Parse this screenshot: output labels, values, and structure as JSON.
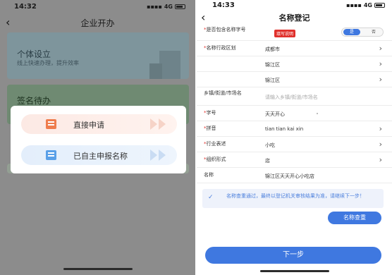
{
  "left": {
    "status": {
      "time": "14:32",
      "network": "4G"
    },
    "nav": {
      "title": "企业开办"
    },
    "card1": {
      "title": "个体设立",
      "subtitle": "线上快速办理，提升效率"
    },
    "card2": {
      "title": "签名待办"
    },
    "modal": {
      "options": [
        {
          "label": "直接申请",
          "icon": "document-icon"
        },
        {
          "label": "已自主申报名称",
          "icon": "form-icon"
        }
      ]
    }
  },
  "right": {
    "status": {
      "time": "14:33",
      "network": "4G"
    },
    "nav": {
      "title": "名称登记"
    },
    "form": {
      "include_name": {
        "label": "是否包含名称字号",
        "required": "*",
        "hint": "填写说明",
        "yes": "是",
        "no": "否",
        "selected": "是"
      },
      "region": {
        "label": "名称行政区划",
        "required": "*",
        "city": "成都市",
        "district": "锦江区",
        "district2": "锦江区"
      },
      "street": {
        "label": "乡镇/街道/市场名",
        "placeholder": "请输入乡镇/街道/市场名"
      },
      "trade_name": {
        "label": "字号",
        "required": "*",
        "value": "天天开心"
      },
      "pinyin": {
        "label": "拼音",
        "required": "*",
        "value": "tian tian kai xin"
      },
      "industry": {
        "label": "行业表述",
        "required": "*",
        "value": "小吃"
      },
      "org_form": {
        "label": "组织形式",
        "required": "*",
        "value": "店"
      },
      "name": {
        "label": "名称",
        "value": "锦江区天天开心小吃店"
      }
    },
    "notice": "名称查重通过，最终以登记机关审核结果为准，请继续下一步！",
    "buttons": {
      "check": "名称查重",
      "next": "下一步"
    }
  }
}
